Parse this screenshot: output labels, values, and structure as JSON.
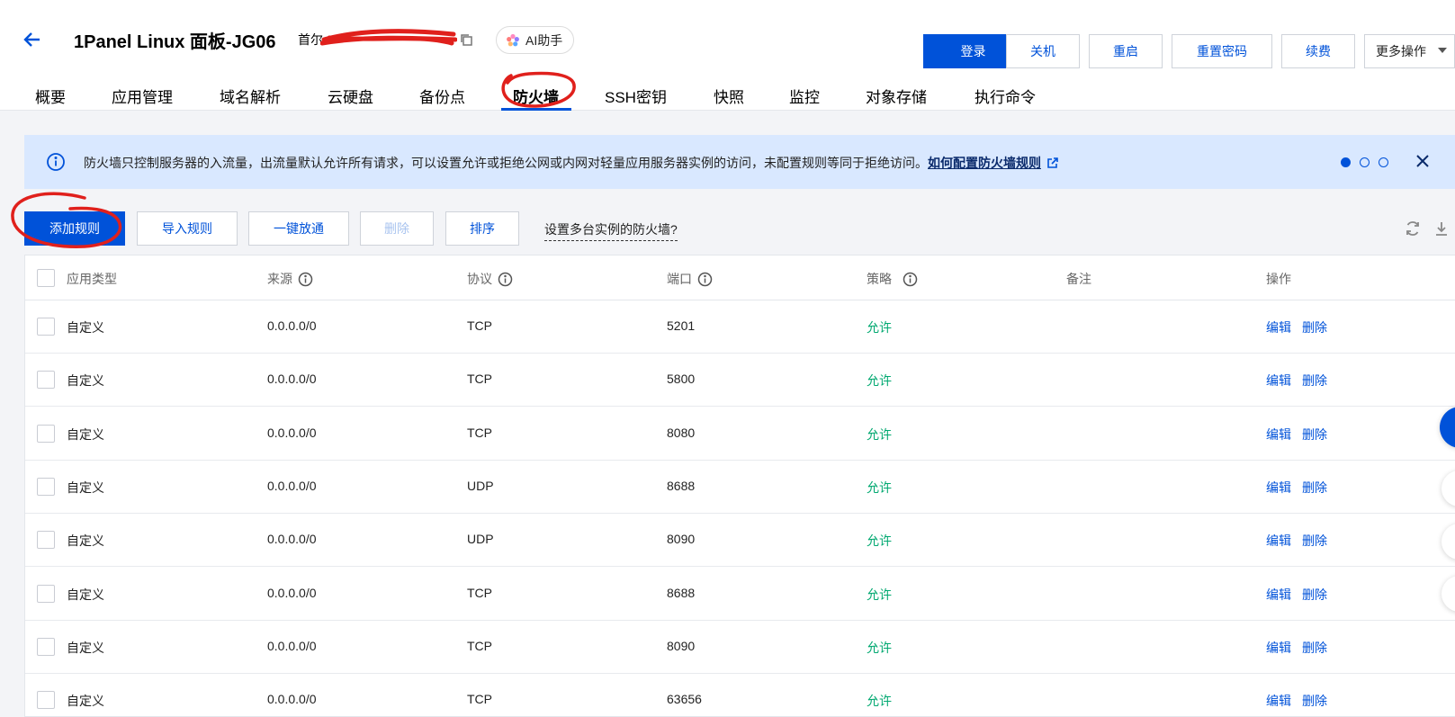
{
  "header": {
    "title": "1Panel Linux 面板-JG06",
    "region": "首尔",
    "ai_label": "AI助手",
    "actions": [
      "登录",
      "关机",
      "重启",
      "重置密码",
      "续费",
      "更多操作"
    ]
  },
  "tabs": [
    "概要",
    "应用管理",
    "域名解析",
    "云硬盘",
    "备份点",
    "防火墙",
    "SSH密钥",
    "快照",
    "监控",
    "对象存储",
    "执行命令"
  ],
  "active_tab": "防火墙",
  "notice": {
    "text": "防火墙只控制服务器的入流量，出流量默认允许所有请求，可以设置允许或拒绝公网或内网对轻量应用服务器实例的访问，未配置规则等同于拒绝访问。",
    "link": "如何配置防火墙规则"
  },
  "toolbar": {
    "add": "添加规则",
    "import": "导入规则",
    "open_all": "一键放通",
    "delete": "删除",
    "sort": "排序",
    "multi": "设置多台实例的防火墙?"
  },
  "table": {
    "headers": [
      "应用类型",
      "来源",
      "协议",
      "端口",
      "策略",
      "备注",
      "操作"
    ],
    "edit_label": "编辑",
    "delete_label": "删除",
    "rows": [
      {
        "type": "自定义",
        "source": "0.0.0.0/0",
        "protocol": "TCP",
        "port": "5201",
        "policy": "允许"
      },
      {
        "type": "自定义",
        "source": "0.0.0.0/0",
        "protocol": "TCP",
        "port": "5800",
        "policy": "允许"
      },
      {
        "type": "自定义",
        "source": "0.0.0.0/0",
        "protocol": "TCP",
        "port": "8080",
        "policy": "允许"
      },
      {
        "type": "自定义",
        "source": "0.0.0.0/0",
        "protocol": "UDP",
        "port": "8688",
        "policy": "允许"
      },
      {
        "type": "自定义",
        "source": "0.0.0.0/0",
        "protocol": "UDP",
        "port": "8090",
        "policy": "允许"
      },
      {
        "type": "自定义",
        "source": "0.0.0.0/0",
        "protocol": "TCP",
        "port": "8688",
        "policy": "允许"
      },
      {
        "type": "自定义",
        "source": "0.0.0.0/0",
        "protocol": "TCP",
        "port": "8090",
        "policy": "允许"
      },
      {
        "type": "自定义",
        "source": "0.0.0.0/0",
        "protocol": "TCP",
        "port": "63656",
        "policy": "允许"
      }
    ]
  },
  "colors": {
    "accent": "#0052d9",
    "allow": "#00a870",
    "annotation": "#e0201c"
  }
}
